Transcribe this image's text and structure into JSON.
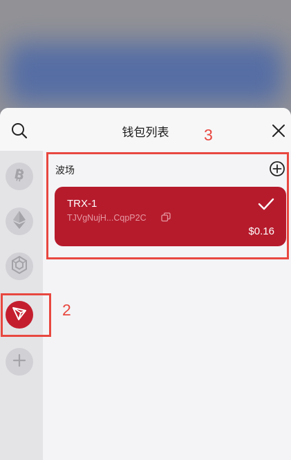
{
  "header": {
    "title": "钱包列表",
    "search_icon": "search-icon",
    "close_icon": "close-icon"
  },
  "chains": [
    {
      "name": "bitcoin",
      "icon": "bitcoin-icon",
      "selected": false
    },
    {
      "name": "ethereum",
      "icon": "ethereum-icon",
      "selected": false
    },
    {
      "name": "bnb",
      "icon": "bnb-icon",
      "selected": false
    },
    {
      "name": "tron",
      "icon": "tron-icon",
      "selected": true
    },
    {
      "name": "add",
      "icon": "plus-icon",
      "selected": false
    }
  ],
  "section": {
    "title": "波场",
    "add_icon": "plus-circle-icon"
  },
  "wallet": {
    "name": "TRX-1",
    "address": "TJVgNujH...CqpP2C",
    "balance": "$0.16",
    "selected": true
  },
  "annotations": {
    "step_chain": "2",
    "step_wallet": "3"
  },
  "colors": {
    "tron_red": "#b61b2c",
    "annotation_red": "#e8473f",
    "sheet_bg": "#f4f4f6",
    "rail_bg": "#e4e4e7"
  }
}
